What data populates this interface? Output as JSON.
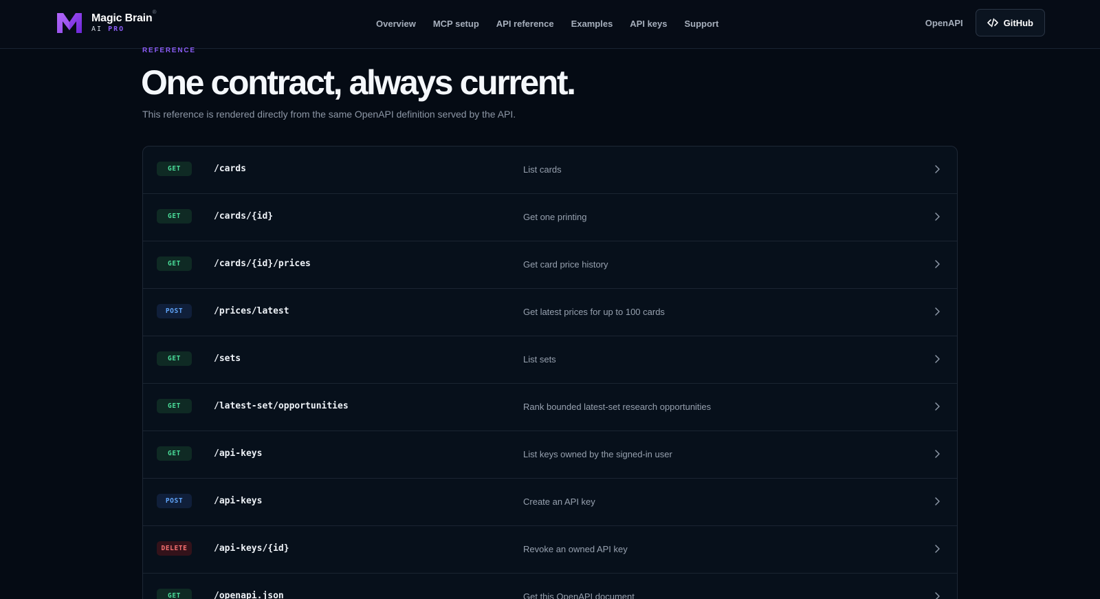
{
  "header": {
    "brand_name": "Magic Brain",
    "brand_sub_ai": "AI",
    "brand_sub_pro": "PRO",
    "brand_mark": "®",
    "nav": [
      "Overview",
      "MCP setup",
      "API reference",
      "Examples",
      "API keys",
      "Support"
    ],
    "openapi_label": "OpenAPI",
    "github_label": "GitHub",
    "github_icon": "code-icon",
    "accent_color": "#8b5cf6"
  },
  "hero": {
    "eyebrow": "REFERENCE",
    "title": "One contract, always current.",
    "subtitle": "This reference is rendered directly from the same OpenAPI definition served by the API."
  },
  "endpoints": [
    {
      "method": "GET",
      "path": "/cards",
      "description": "List cards"
    },
    {
      "method": "GET",
      "path": "/cards/{id}",
      "description": "Get one printing"
    },
    {
      "method": "GET",
      "path": "/cards/{id}/prices",
      "description": "Get card price history"
    },
    {
      "method": "POST",
      "path": "/prices/latest",
      "description": "Get latest prices for up to 100 cards"
    },
    {
      "method": "GET",
      "path": "/sets",
      "description": "List sets"
    },
    {
      "method": "GET",
      "path": "/latest-set/opportunities",
      "description": "Rank bounded latest-set research opportunities"
    },
    {
      "method": "GET",
      "path": "/api-keys",
      "description": "List keys owned by the signed-in user"
    },
    {
      "method": "POST",
      "path": "/api-keys",
      "description": "Create an API key"
    },
    {
      "method": "DELETE",
      "path": "/api-keys/{id}",
      "description": "Revoke an owned API key"
    },
    {
      "method": "GET",
      "path": "/openapi.json",
      "description": "Get this OpenAPI document"
    }
  ]
}
